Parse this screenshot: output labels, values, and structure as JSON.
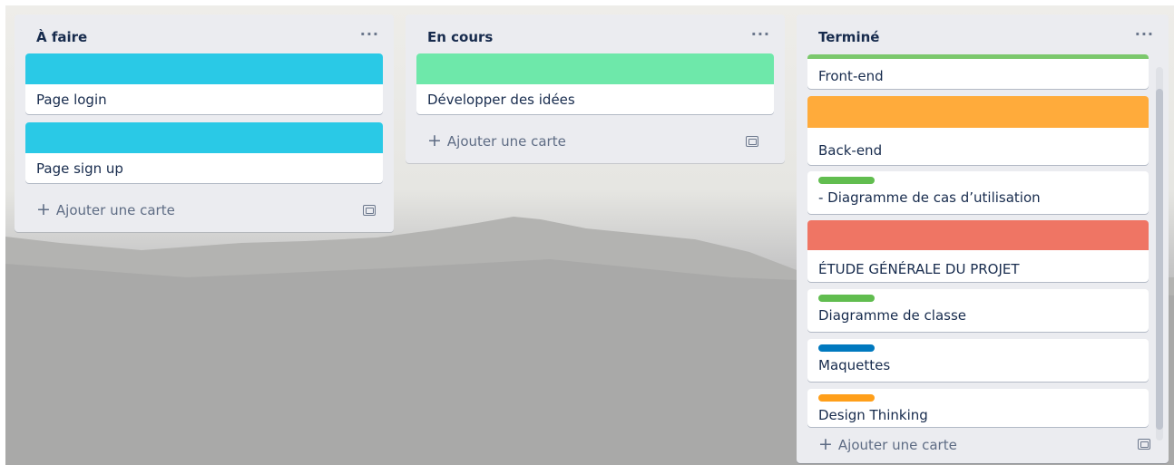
{
  "board": {
    "lists": [
      {
        "title": "À faire",
        "menu": "···",
        "cards": [
          {
            "cover": "#2ac9e6",
            "title": "Page login"
          },
          {
            "cover": "#2ac9e6",
            "title": "Page sign up"
          }
        ],
        "add_label": "Ajouter une carte"
      },
      {
        "title": "En cours",
        "menu": "···",
        "cards": [
          {
            "cover": "#6ee8aa",
            "title": "Développer des idées"
          }
        ],
        "add_label": "Ajouter une carte"
      },
      {
        "title": "Terminé",
        "menu": "···",
        "cards": [
          {
            "cover_strip": "#7bc86c",
            "title": "Front-end"
          },
          {
            "cover": "#ffab3b",
            "title": "Back-end"
          },
          {
            "label": "#61bd4f",
            "title": "- Diagramme de cas d’utilisation"
          },
          {
            "cover": "#ef7564",
            "title": "ÉTUDE GÉNÉRALE DU PROJET"
          },
          {
            "label": "#61bd4f",
            "title": "Diagramme de classe"
          },
          {
            "label": "#0079bf",
            "title": "Maquettes"
          },
          {
            "label": "#ff9f1a",
            "title": "Design Thinking"
          }
        ],
        "add_label": "Ajouter une carte"
      }
    ]
  },
  "icons": {
    "add": "plus-icon",
    "template": "card-template-icon",
    "menu": "ellipsis-icon"
  }
}
